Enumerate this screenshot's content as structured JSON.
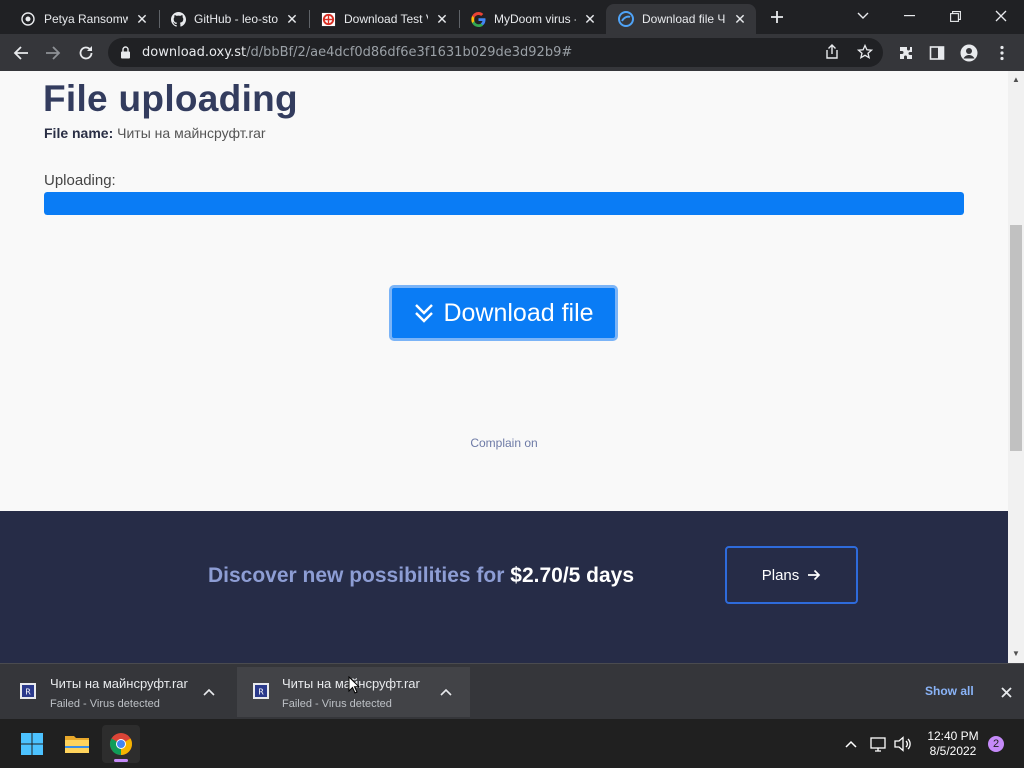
{
  "browser": {
    "tabs": [
      {
        "title": "Petya Ransomware",
        "favicon": "globe-icon"
      },
      {
        "title": "GitHub - leo-stone",
        "favicon": "github-icon"
      },
      {
        "title": "Download Test Virus",
        "favicon": "test-site-icon"
      },
      {
        "title": "MyDoom virus - Go",
        "favicon": "google-icon"
      },
      {
        "title": "Download file Читы",
        "favicon": "oxy-icon",
        "active": true
      }
    ],
    "url_host": "download.oxy.st",
    "url_path": "/d/bbBf/2/ae4dcf0d86df6e3f1631b029de3d92b9#"
  },
  "page": {
    "title": "File uploading",
    "file_name_label": "File name:",
    "file_name": "Читы на майнсруфт.rar",
    "uploading_label": "Uploading:",
    "upload_progress": 1.0,
    "download_button": "Download file",
    "complain_link": "Complain on"
  },
  "promo": {
    "text": "Discover new possibilities for",
    "price": "$2.70/5 days",
    "plans_button": "Plans"
  },
  "downloads": {
    "items": [
      {
        "name": "Читы на майнсруфт.rar",
        "status": "Failed - Virus detected"
      },
      {
        "name": "Читы на майнсруфт.rar",
        "status": "Failed - Virus detected"
      }
    ],
    "show_all": "Show all"
  },
  "taskbar": {
    "time": "12:40 PM",
    "date": "8/5/2022",
    "notifications": "2"
  },
  "colors": {
    "accent": "#0a7cf5",
    "title": "#333c5e",
    "promo_bg": "#262c47"
  }
}
